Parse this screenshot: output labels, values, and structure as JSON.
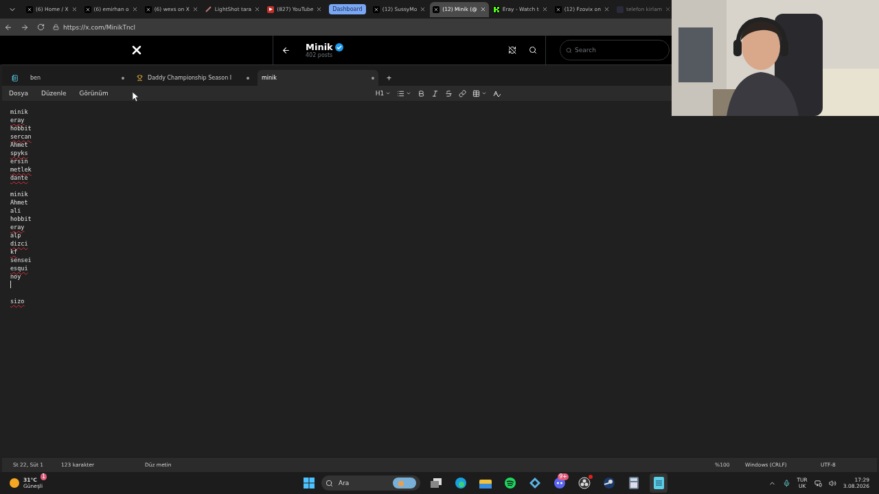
{
  "browser": {
    "tabs": [
      {
        "kind": "x",
        "title": "(6) Home / X",
        "selected": false
      },
      {
        "kind": "x",
        "title": "(6) emirhan o",
        "selected": false
      },
      {
        "kind": "x",
        "title": "(6) wexs on X",
        "selected": false
      },
      {
        "kind": "pen",
        "title": "LightShot tara",
        "selected": false
      },
      {
        "kind": "youtube",
        "title": "(827) YouTube",
        "selected": false
      },
      {
        "kind": "group",
        "title": "Dashboard",
        "selected": false
      },
      {
        "kind": "x",
        "title": "(12) SussyMo",
        "selected": false
      },
      {
        "kind": "x",
        "title": "(12) Minik (@",
        "selected": true
      },
      {
        "kind": "kick",
        "title": "Eray - Watch t",
        "selected": false
      },
      {
        "kind": "x",
        "title": "(12) Fzovix on",
        "selected": false
      },
      {
        "kind": "faint",
        "title": "telefon kirlam",
        "selected": false
      }
    ],
    "url": "https://x.com/MinikTncl"
  },
  "x_header": {
    "name": "Minik",
    "posts": "402 posts",
    "search_placeholder": "Search"
  },
  "notepad": {
    "tabs": [
      {
        "title": "ben",
        "kind": "notepad",
        "selected": false
      },
      {
        "title": "Daddy Championship Season I",
        "kind": "trophy",
        "selected": false
      },
      {
        "title": "minik",
        "kind": "plain",
        "selected": true
      }
    ],
    "new_tab": "+",
    "menu": [
      "Dosya",
      "Düzenle",
      "Görünüm"
    ],
    "heading_button": "H1",
    "lines": [
      {
        "kind": "text",
        "text": "minik",
        "misspelled": false
      },
      {
        "kind": "text",
        "text": "eray",
        "misspelled": true
      },
      {
        "kind": "text",
        "text": "hobbit",
        "misspelled": false
      },
      {
        "kind": "text",
        "text": "sercan",
        "misspelled": true
      },
      {
        "kind": "text",
        "text": "Ahmet",
        "misspelled": false
      },
      {
        "kind": "text",
        "text": "spyks",
        "misspelled": true
      },
      {
        "kind": "text",
        "text": "ersin",
        "misspelled": false
      },
      {
        "kind": "text",
        "text": "metlek",
        "misspelled": true
      },
      {
        "kind": "text",
        "text": "dante",
        "misspelled": true
      },
      {
        "kind": "blank"
      },
      {
        "kind": "text",
        "text": "minik",
        "misspelled": false
      },
      {
        "kind": "text",
        "text": "Ahmet",
        "misspelled": false
      },
      {
        "kind": "text",
        "text": "ali",
        "misspelled": false
      },
      {
        "kind": "text",
        "text": "hobbit",
        "misspelled": false
      },
      {
        "kind": "text",
        "text": "eray",
        "misspelled": true
      },
      {
        "kind": "text",
        "text": "alp",
        "misspelled": false
      },
      {
        "kind": "text",
        "text": "dizci",
        "misspelled": true
      },
      {
        "kind": "text",
        "text": "kf",
        "misspelled": true
      },
      {
        "kind": "text",
        "text": "sensei",
        "misspelled": false
      },
      {
        "kind": "text",
        "text": "esqui",
        "misspelled": true
      },
      {
        "kind": "text",
        "text": "noy",
        "misspelled": false
      },
      {
        "kind": "caret"
      },
      {
        "kind": "blank"
      },
      {
        "kind": "text",
        "text": "sizo",
        "misspelled": true
      }
    ],
    "status": {
      "position": "St 22, Süt 1",
      "count": "123 karakter",
      "format": "Düz metin",
      "zoom": "%100",
      "line_ending": "Windows (CRLF)",
      "encoding": "UTF-8"
    }
  },
  "taskbar": {
    "weather": {
      "badge": "1",
      "temp": "31°C",
      "condition": "Güneşli"
    },
    "search": "Ara",
    "apps": [
      {
        "kind": "taskview",
        "alert": false,
        "active": false
      },
      {
        "kind": "edge",
        "alert": false,
        "active": false
      },
      {
        "kind": "folder",
        "alert": false,
        "active": false
      },
      {
        "kind": "spotify",
        "alert": false,
        "active": false
      },
      {
        "kind": "gem",
        "alert": false,
        "active": false
      },
      {
        "kind": "discord",
        "badge": "9+",
        "alert": false,
        "active": false
      },
      {
        "kind": "obs",
        "alert": true,
        "active": false
      },
      {
        "kind": "steam",
        "alert": false,
        "active": false
      },
      {
        "kind": "calculator",
        "alert": false,
        "active": false
      },
      {
        "kind": "notepad",
        "alert": false,
        "active": true
      }
    ],
    "lang": "TUR",
    "layout": "UK",
    "time": "17:29",
    "date": "3.08.2026"
  }
}
